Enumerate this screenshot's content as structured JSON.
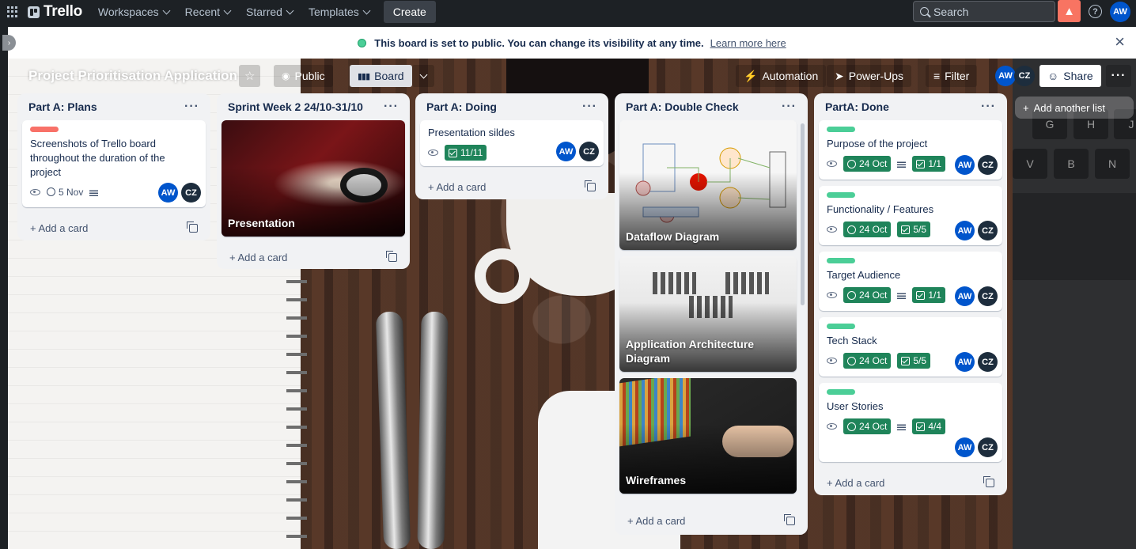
{
  "nav": {
    "brand": "Trello",
    "menus": [
      "Workspaces",
      "Recent",
      "Starred",
      "Templates"
    ],
    "create": "Create",
    "search_placeholder": "Search",
    "user_initials": "AW"
  },
  "banner": {
    "message": "This board is set to public. You can change its visibility at any time.",
    "link": "Learn more here"
  },
  "board": {
    "title": "Project Prioritisation Application",
    "visibility": "Public",
    "view": "Board",
    "automation": "Automation",
    "powerups": "Power-Ups",
    "filter": "Filter",
    "share": "Share",
    "members": [
      "AW",
      "CZ"
    ],
    "add_list": "Add another list"
  },
  "background_keys": [
    "G",
    "H",
    "J",
    "V",
    "B",
    "N"
  ],
  "lists": [
    {
      "name": "Part A: Plans",
      "cards": [
        {
          "title": "Screenshots of Trello board throughout the duration of the project",
          "label_color": "#f87168",
          "date": "5 Nov",
          "members": [
            "AW",
            "CZ"
          ]
        }
      ],
      "add": "Add a card"
    },
    {
      "name": "Sprint Week 2 24/10-31/10",
      "cards": [
        {
          "title": "Presentation",
          "cover": "projector"
        }
      ],
      "add": "Add a card"
    },
    {
      "name": "Part A: Doing",
      "cards": [
        {
          "title": "Presentation sildes",
          "checklist": "11/11",
          "members": [
            "AW",
            "CZ"
          ]
        }
      ],
      "add": "Add a card"
    },
    {
      "name": "Part A: Double Check",
      "cards": [
        {
          "title": "Dataflow Diagram",
          "cover": "diagram"
        },
        {
          "title": "Application Architecture Diagram",
          "cover": "architecture"
        },
        {
          "title": "Wireframes",
          "cover": "sketch"
        }
      ],
      "add": "Add a card"
    },
    {
      "name": "PartA: Done",
      "cards": [
        {
          "title": "Purpose of the project",
          "date": "24 Oct",
          "checklist": "1/1",
          "members": [
            "AW",
            "CZ"
          ]
        },
        {
          "title": "Functionality / Features",
          "date": "24 Oct",
          "checklist": "5/5",
          "members": [
            "AW",
            "CZ"
          ]
        },
        {
          "title": "Target Audience",
          "date": "24 Oct",
          "checklist": "1/1",
          "members": [
            "AW",
            "CZ"
          ]
        },
        {
          "title": "Tech Stack",
          "date": "24 Oct",
          "checklist": "5/5",
          "members": [
            "AW",
            "CZ"
          ]
        },
        {
          "title": "User Stories",
          "date": "24 Oct",
          "checklist": "4/4",
          "members": [
            "AW",
            "CZ"
          ]
        }
      ],
      "add": "Add a card"
    }
  ]
}
